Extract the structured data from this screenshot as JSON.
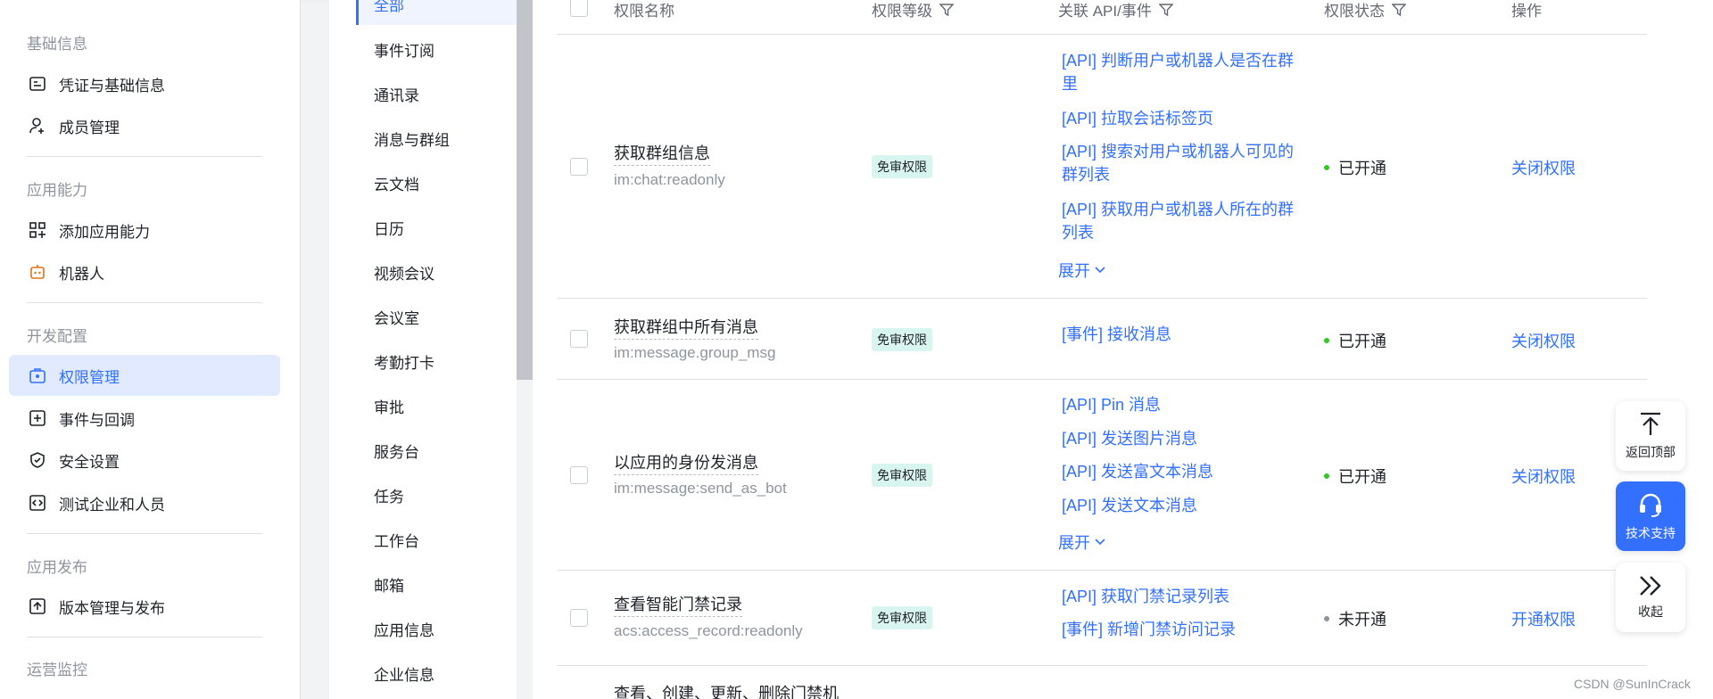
{
  "sidebar": {
    "groups": [
      {
        "title": "基础信息",
        "items": [
          {
            "label": "凭证与基础信息",
            "icon": "credential-icon"
          },
          {
            "label": "成员管理",
            "icon": "user-add-icon"
          }
        ]
      },
      {
        "title": "应用能力",
        "items": [
          {
            "label": "添加应用能力",
            "icon": "apps-add-icon"
          },
          {
            "label": "机器人",
            "icon": "robot-icon"
          }
        ]
      },
      {
        "title": "开发配置",
        "items": [
          {
            "label": "权限管理",
            "icon": "permission-icon"
          },
          {
            "label": "事件与回调",
            "icon": "event-icon"
          },
          {
            "label": "安全设置",
            "icon": "shield-icon"
          },
          {
            "label": "测试企业和人员",
            "icon": "code-icon"
          }
        ]
      },
      {
        "title": "应用发布",
        "items": [
          {
            "label": "版本管理与发布",
            "icon": "upload-icon"
          }
        ]
      },
      {
        "title": "运营监控",
        "items": []
      }
    ]
  },
  "categories": {
    "active": "全部",
    "items": [
      "事件订阅",
      "通讯录",
      "消息与群组",
      "云文档",
      "日历",
      "视频会议",
      "会议室",
      "考勤打卡",
      "审批",
      "服务台",
      "任务",
      "工作台",
      "邮箱",
      "应用信息",
      "企业信息"
    ]
  },
  "table": {
    "headers": {
      "name": "权限名称",
      "level": "权限等级",
      "api": "关联 API/事件",
      "status": "权限状态",
      "action": "操作"
    },
    "rows": [
      {
        "name": "获取群组信息",
        "code": "im:chat:readonly",
        "badge": "免审权限",
        "apis": [
          "[API] 判断用户或机器人是否在群里",
          "[API] 拉取会话标签页",
          "[API] 搜索对用户或机器人可见的群列表",
          "[API] 获取用户或机器人所在的群列表"
        ],
        "expand": "展开",
        "status": "已开通",
        "action": "关闭权限"
      },
      {
        "name": "获取群组中所有消息",
        "code": "im:message.group_msg",
        "badge": "免审权限",
        "apis": [
          "[事件] 接收消息"
        ],
        "status": "已开通",
        "action": "关闭权限"
      },
      {
        "name": "以应用的身份发消息",
        "code": "im:message:send_as_bot",
        "badge": "免审权限",
        "apis": [
          "[API] Pin 消息",
          "[API] 发送图片消息",
          "[API] 发送富文本消息",
          "[API] 发送文本消息"
        ],
        "expand": "展开",
        "status": "已开通",
        "action": "关闭权限"
      },
      {
        "name": "查看智能门禁记录",
        "code": "acs:access_record:readonly",
        "badge": "免审权限",
        "apis": [
          "[API] 获取门禁记录列表",
          "[事件] 新增门禁访问记录"
        ],
        "status": "未开通",
        "action": "开通权限"
      },
      {
        "name": "查看、创建、更新、删除门禁机"
      }
    ]
  },
  "floating": {
    "back_top": "返回顶部",
    "support": "技术支持",
    "collapse": "收起"
  },
  "watermark": "CSDN @SunInCrack",
  "colors": {
    "accent": "#3370ff",
    "enabled": "#34c724",
    "disabled": "#8f959e",
    "badge_bg": "#d9f5f0"
  }
}
